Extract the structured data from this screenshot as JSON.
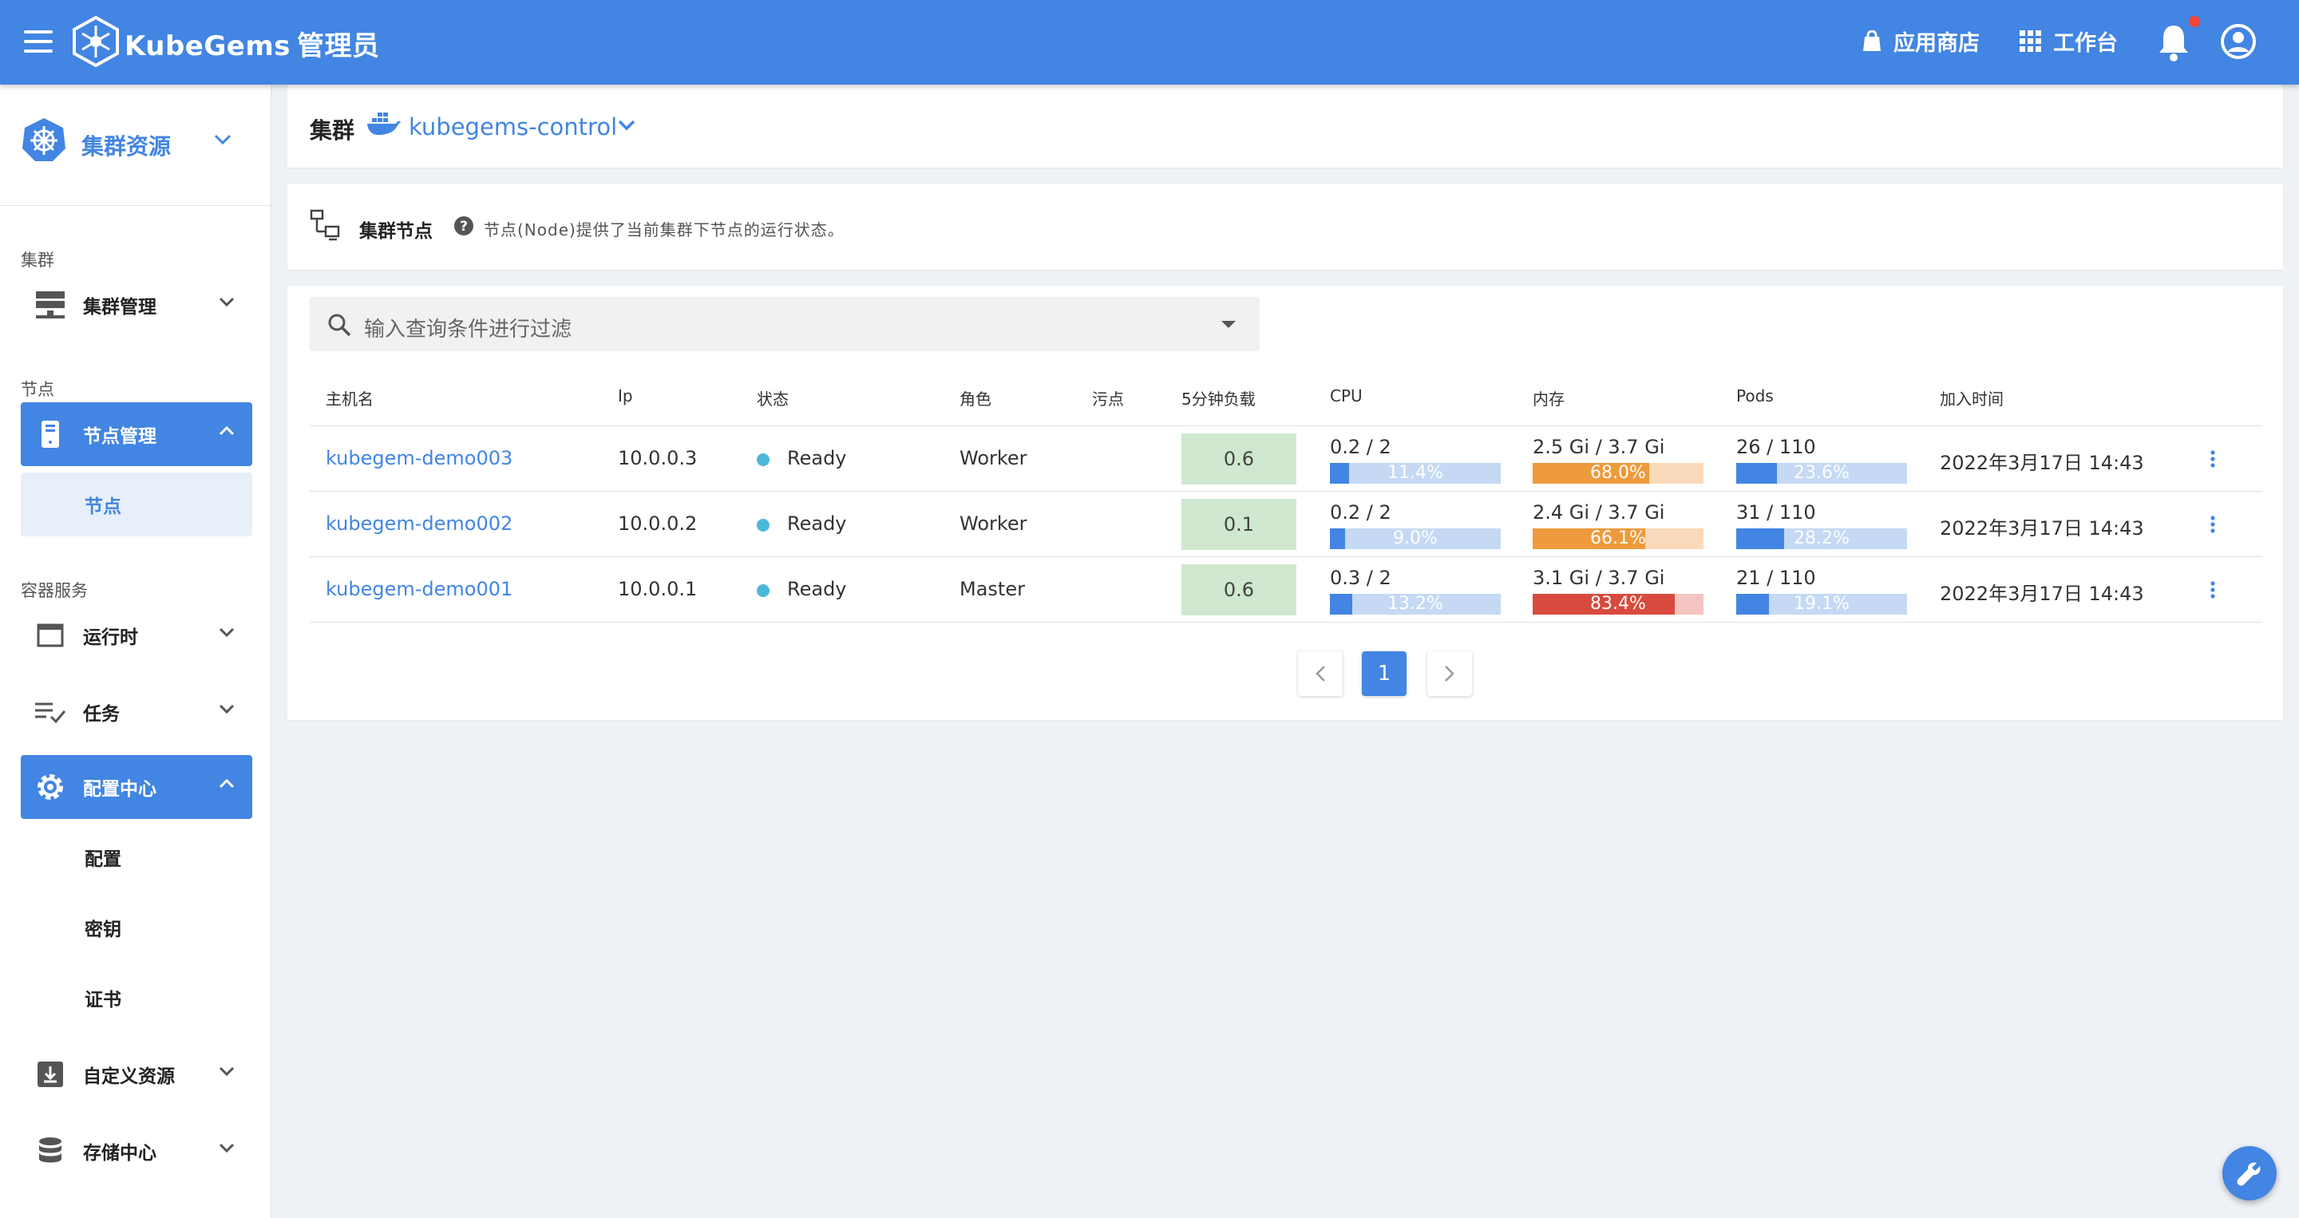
{
  "app": {
    "brand": "KubeGems",
    "role": "管理员"
  },
  "topbar": {
    "app_store": "应用商店",
    "workbench": "工作台"
  },
  "sidebar": {
    "header": "集群资源",
    "sections": {
      "cluster": "集群",
      "node": "节点",
      "container": "容器服务"
    },
    "items": {
      "cluster_mgmt": "集群管理",
      "node_mgmt": "节点管理",
      "node": "节点",
      "runtime": "运行时",
      "jobs": "任务",
      "config_center": "配置中心",
      "config": "配置",
      "secret": "密钥",
      "cert": "证书",
      "crd": "自定义资源",
      "storage": "存储中心"
    }
  },
  "cluster_bar": {
    "label": "集群",
    "cluster_name": "kubegems-control"
  },
  "page_header": {
    "title": "集群节点",
    "description": "节点(Node)提供了当前集群下节点的运行状态。"
  },
  "search": {
    "placeholder": "输入查询条件进行过滤"
  },
  "table": {
    "headers": [
      "主机名",
      "Ip",
      "状态",
      "角色",
      "污点",
      "5分钟负载",
      "CPU",
      "内存",
      "Pods",
      "加入时间"
    ],
    "rows": [
      {
        "host": "kubegem-demo003",
        "ip": "10.0.0.3",
        "status": "Ready",
        "role": "Worker",
        "taint": "",
        "load": "0.6",
        "cpu": {
          "text": "0.2 / 2",
          "pct": "11.4%",
          "value": 11.4,
          "color": "#4285e2",
          "track": "#c5d9f4"
        },
        "mem": {
          "text": "2.5 Gi / 3.7 Gi",
          "pct": "68.0%",
          "value": 68.0,
          "color": "#ef9a3c",
          "track": "#fbd9bb"
        },
        "pods": {
          "text": "26 / 110",
          "pct": "23.6%",
          "value": 23.6,
          "color": "#4285e2",
          "track": "#c5d9f4"
        },
        "joined": "2022年3月17日 14:43"
      },
      {
        "host": "kubegem-demo002",
        "ip": "10.0.0.2",
        "status": "Ready",
        "role": "Worker",
        "taint": "",
        "load": "0.1",
        "cpu": {
          "text": "0.2 / 2",
          "pct": "9.0%",
          "value": 9.0,
          "color": "#4285e2",
          "track": "#c5d9f4"
        },
        "mem": {
          "text": "2.4 Gi / 3.7 Gi",
          "pct": "66.1%",
          "value": 66.1,
          "color": "#ef9a3c",
          "track": "#fbd9bb"
        },
        "pods": {
          "text": "31 / 110",
          "pct": "28.2%",
          "value": 28.2,
          "color": "#4285e2",
          "track": "#c5d9f4"
        },
        "joined": "2022年3月17日 14:43"
      },
      {
        "host": "kubegem-demo001",
        "ip": "10.0.0.1",
        "status": "Ready",
        "role": "Master",
        "taint": "",
        "load": "0.6",
        "cpu": {
          "text": "0.3 / 2",
          "pct": "13.2%",
          "value": 13.2,
          "color": "#4285e2",
          "track": "#c5d9f4"
        },
        "mem": {
          "text": "3.1 Gi / 3.7 Gi",
          "pct": "83.4%",
          "value": 83.4,
          "color": "#d94a3e",
          "track": "#f4c5c1"
        },
        "pods": {
          "text": "21 / 110",
          "pct": "19.1%",
          "value": 19.1,
          "color": "#4285e2",
          "track": "#c5d9f4"
        },
        "joined": "2022年3月17日 14:43"
      }
    ]
  },
  "pagination": {
    "current": "1"
  },
  "icons": {
    "menu": "menu-icon",
    "logo": "kubegems-logo-icon",
    "store": "shopping-bag-icon",
    "apps": "grid-icon",
    "notifications": "bell-icon",
    "account": "account-circle-icon",
    "k8s": "kubernetes-icon",
    "docker": "docker-icon",
    "fab": "wrench-icon"
  },
  "colors": {
    "primary": "#4285e2",
    "ready": "#4cb8d9",
    "load_bg": "#cfe8cf"
  }
}
